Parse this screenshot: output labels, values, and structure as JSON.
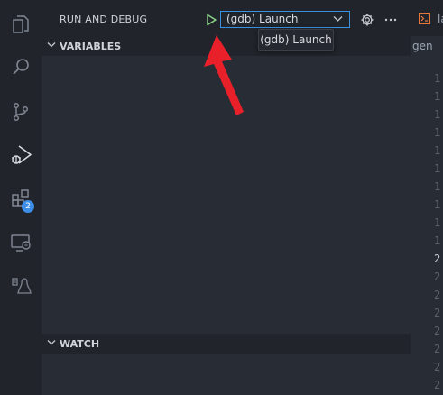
{
  "activity_bar": {
    "items": [
      {
        "icon": "files-icon"
      },
      {
        "icon": "search-icon"
      },
      {
        "icon": "source-control-icon"
      },
      {
        "icon": "run-debug-icon"
      },
      {
        "icon": "extensions-icon",
        "badge": "2"
      },
      {
        "icon": "remote-explorer-icon"
      },
      {
        "icon": "wsl-icon"
      }
    ]
  },
  "sidebar": {
    "title": "RUN AND DEBUG",
    "run_config": {
      "selected": "(gdb) Launch"
    },
    "tooltip": "(gdb) Launch",
    "sections": {
      "variables": "VARIABLES",
      "watch": "WATCH"
    }
  },
  "editor": {
    "tab_label": "la",
    "breadcrumb": "gen",
    "line_numbers": [
      "1",
      "1",
      "1",
      "1",
      "1",
      "1",
      "1",
      "1",
      "1",
      "1",
      "2",
      "2",
      "2",
      "2",
      "2",
      "2",
      "2",
      "2"
    ],
    "active_line_index": 10
  },
  "colors": {
    "accent": "#3c90e0",
    "run_green": "#89d185",
    "badge": "#3c8ee8",
    "annotation_arrow": "#e8202a"
  }
}
